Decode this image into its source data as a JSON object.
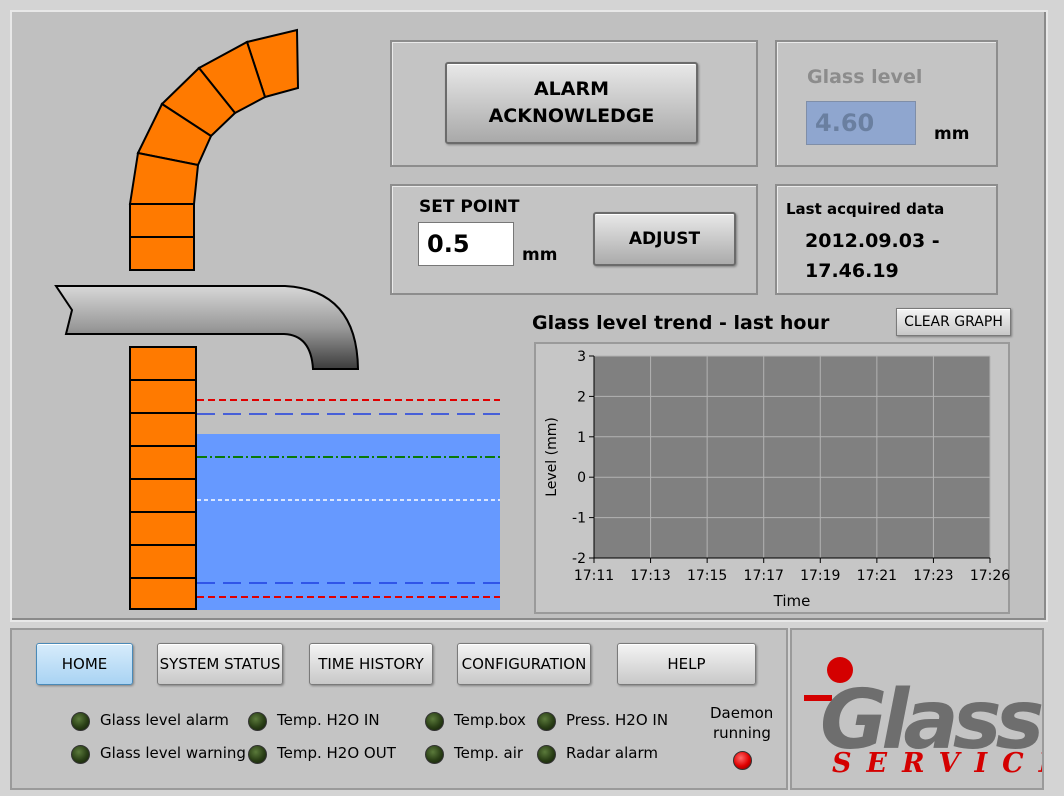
{
  "alarm_button": {
    "line1": "ALARM",
    "line2": "ACKNOWLEDGE"
  },
  "glass_level": {
    "label": "Glass level",
    "value": "4.60",
    "unit": "mm"
  },
  "set_point": {
    "label": "SET POINT",
    "value": "0.5",
    "unit": "mm",
    "adjust_label": "ADJUST"
  },
  "last_acquired": {
    "label": "Last acquired data",
    "line1": "2012.09.03 -",
    "line2": "17.46.19"
  },
  "graph": {
    "title": "Glass level trend - last hour",
    "clear_label": "CLEAR GRAPH"
  },
  "chart_data": {
    "type": "line",
    "title": "Glass level trend - last hour",
    "xlabel": "Time",
    "ylabel": "Level (mm)",
    "ylim": [
      -2,
      3
    ],
    "yticks": [
      "3",
      "2",
      "1",
      "0",
      "-1",
      "-2"
    ],
    "xticks": [
      "17:11",
      "17:13",
      "17:15",
      "17:17",
      "17:19",
      "17:21",
      "17:23",
      "17:26"
    ],
    "series": [],
    "grid": true
  },
  "nav": [
    {
      "label": "HOME",
      "active": true
    },
    {
      "label": "SYSTEM STATUS"
    },
    {
      "label": "TIME HISTORY"
    },
    {
      "label": "CONFIGURATION"
    },
    {
      "label": "HELP"
    }
  ],
  "indicators": [
    {
      "label": "Glass level alarm"
    },
    {
      "label": "Glass level warning"
    },
    {
      "label": "Temp. H2O IN"
    },
    {
      "label": "Temp. H2O OUT"
    },
    {
      "label": "Temp.box"
    },
    {
      "label": "Temp. air"
    },
    {
      "label": "Press. H2O IN"
    },
    {
      "label": "Radar alarm"
    }
  ],
  "daemon": {
    "line1": "Daemon",
    "line2": "running"
  },
  "logo": {
    "word": "Glass",
    "sub": "SERVICE"
  },
  "colors": {
    "brick": "#ff7a00",
    "glass": "#6699ff",
    "plot_bg": "#808080",
    "led_off": "#2a3f16",
    "led_on": "#e00000",
    "logo_red": "#d40000"
  }
}
